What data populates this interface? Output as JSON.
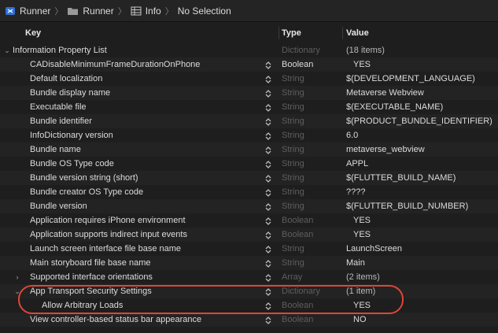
{
  "breadcrumb": [
    {
      "label": "Runner",
      "icon": "xcode-project-icon"
    },
    {
      "label": "Runner",
      "icon": "folder-icon"
    },
    {
      "label": "Info",
      "icon": "plist-table-icon"
    },
    {
      "label": "No Selection",
      "icon": ""
    }
  ],
  "columns": {
    "key": "Key",
    "type": "Type",
    "value": "Value"
  },
  "rows": [
    {
      "key": "Information Property List",
      "type": "Dictionary",
      "value": "(18 items)",
      "disclosure": "expanded",
      "level": 0,
      "stepper": false,
      "typeStyle": "gray",
      "valueStyle": "count"
    },
    {
      "key": "CADisableMinimumFrameDurationOnPhone",
      "type": "Boolean",
      "value": "YES",
      "disclosure": "",
      "level": 1,
      "stepper": true,
      "typeStyle": "bright",
      "valueStyle": "bool"
    },
    {
      "key": "Default localization",
      "type": "String",
      "value": "$(DEVELOPMENT_LANGUAGE)",
      "disclosure": "",
      "level": 1,
      "stepper": true,
      "typeStyle": "gray",
      "valueStyle": ""
    },
    {
      "key": "Bundle display name",
      "type": "String",
      "value": "Metaverse Webview",
      "disclosure": "",
      "level": 1,
      "stepper": true,
      "typeStyle": "gray",
      "valueStyle": ""
    },
    {
      "key": "Executable file",
      "type": "String",
      "value": "$(EXECUTABLE_NAME)",
      "disclosure": "",
      "level": 1,
      "stepper": true,
      "typeStyle": "gray",
      "valueStyle": ""
    },
    {
      "key": "Bundle identifier",
      "type": "String",
      "value": "$(PRODUCT_BUNDLE_IDENTIFIER)",
      "disclosure": "",
      "level": 1,
      "stepper": true,
      "typeStyle": "gray",
      "valueStyle": ""
    },
    {
      "key": "InfoDictionary version",
      "type": "String",
      "value": "6.0",
      "disclosure": "",
      "level": 1,
      "stepper": true,
      "typeStyle": "gray",
      "valueStyle": ""
    },
    {
      "key": "Bundle name",
      "type": "String",
      "value": "metaverse_webview",
      "disclosure": "",
      "level": 1,
      "stepper": true,
      "typeStyle": "gray",
      "valueStyle": ""
    },
    {
      "key": "Bundle OS Type code",
      "type": "String",
      "value": "APPL",
      "disclosure": "",
      "level": 1,
      "stepper": true,
      "typeStyle": "gray",
      "valueStyle": ""
    },
    {
      "key": "Bundle version string (short)",
      "type": "String",
      "value": "$(FLUTTER_BUILD_NAME)",
      "disclosure": "",
      "level": 1,
      "stepper": true,
      "typeStyle": "gray",
      "valueStyle": ""
    },
    {
      "key": "Bundle creator OS Type code",
      "type": "String",
      "value": "????",
      "disclosure": "",
      "level": 1,
      "stepper": true,
      "typeStyle": "gray",
      "valueStyle": ""
    },
    {
      "key": "Bundle version",
      "type": "String",
      "value": "$(FLUTTER_BUILD_NUMBER)",
      "disclosure": "",
      "level": 1,
      "stepper": true,
      "typeStyle": "gray",
      "valueStyle": ""
    },
    {
      "key": "Application requires iPhone environment",
      "type": "Boolean",
      "value": "YES",
      "disclosure": "",
      "level": 1,
      "stepper": true,
      "typeStyle": "gray",
      "valueStyle": "bool"
    },
    {
      "key": "Application supports indirect input events",
      "type": "Boolean",
      "value": "YES",
      "disclosure": "",
      "level": 1,
      "stepper": true,
      "typeStyle": "gray",
      "valueStyle": "bool"
    },
    {
      "key": "Launch screen interface file base name",
      "type": "String",
      "value": "LaunchScreen",
      "disclosure": "",
      "level": 1,
      "stepper": true,
      "typeStyle": "gray",
      "valueStyle": ""
    },
    {
      "key": "Main storyboard file base name",
      "type": "String",
      "value": "Main",
      "disclosure": "",
      "level": 1,
      "stepper": true,
      "typeStyle": "gray",
      "valueStyle": ""
    },
    {
      "key": "Supported interface orientations",
      "type": "Array",
      "value": "(2 items)",
      "disclosure": "collapsed",
      "level": 1,
      "stepper": true,
      "typeStyle": "gray",
      "valueStyle": "count"
    },
    {
      "key": "App Transport Security Settings",
      "type": "Dictionary",
      "value": "(1 item)",
      "disclosure": "expanded",
      "level": 1,
      "stepper": true,
      "typeStyle": "gray",
      "valueStyle": "count"
    },
    {
      "key": "Allow Arbitrary Loads",
      "type": "Boolean",
      "value": "YES",
      "disclosure": "",
      "level": 2,
      "stepper": true,
      "typeStyle": "gray",
      "valueStyle": "bool"
    },
    {
      "key": "View controller-based status bar appearance",
      "type": "Boolean",
      "value": "NO",
      "disclosure": "",
      "level": 1,
      "stepper": true,
      "typeStyle": "gray",
      "valueStyle": "bool"
    }
  ],
  "highlight_color": "#e0453a"
}
